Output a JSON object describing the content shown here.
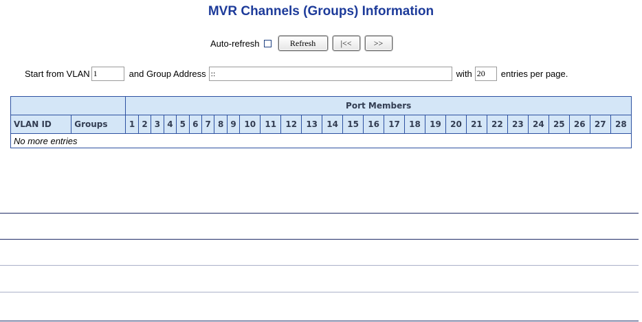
{
  "page": {
    "title": "MVR Channels (Groups) Information"
  },
  "controls": {
    "auto_refresh_label": "Auto-refresh",
    "auto_refresh_checked": false,
    "refresh_label": "Refresh",
    "first_label": "|<<",
    "next_label": ">>"
  },
  "filter": {
    "start_label": "Start from VLAN",
    "vlan_value": "1",
    "group_label": "and Group Address",
    "group_value": "::",
    "with_label": "with",
    "entries_value": "20",
    "entries_suffix": "entries per page."
  },
  "table": {
    "port_members_header": "Port Members",
    "vlan_id_header": "VLAN ID",
    "groups_header": "Groups",
    "ports": [
      "1",
      "2",
      "3",
      "4",
      "5",
      "6",
      "7",
      "8",
      "9",
      "10",
      "11",
      "12",
      "13",
      "14",
      "15",
      "16",
      "17",
      "18",
      "19",
      "20",
      "21",
      "22",
      "23",
      "24",
      "25",
      "26",
      "27",
      "28"
    ],
    "empty_message": "No more entries"
  }
}
